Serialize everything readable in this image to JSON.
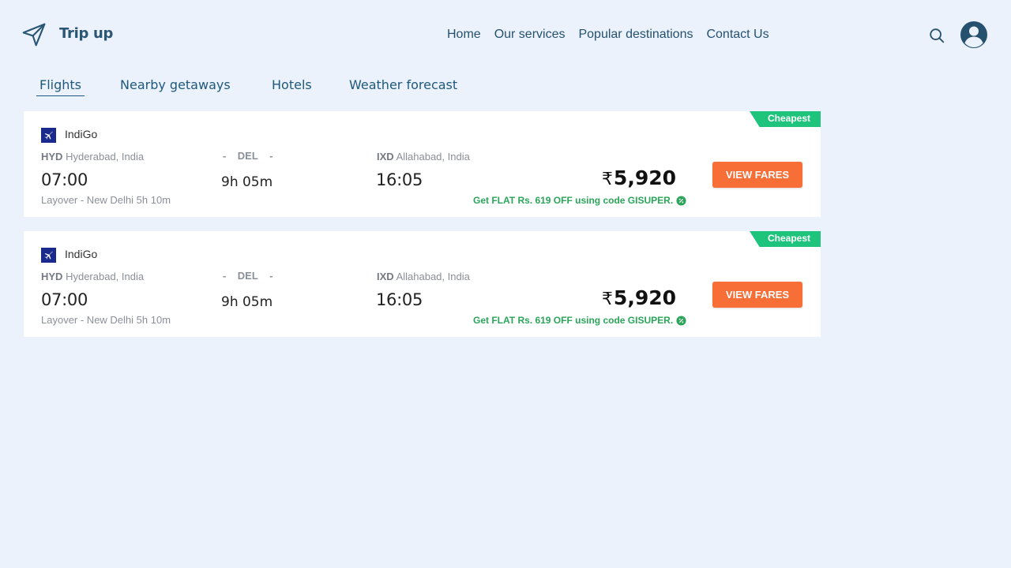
{
  "header": {
    "brand": "Trip up",
    "nav": [
      "Home",
      "Our services",
      "Popular destinations",
      "Contact Us"
    ]
  },
  "tabs": [
    "Flights",
    "Nearby getaways",
    "Hotels",
    "Weather forecast"
  ],
  "active_tab": "Flights",
  "flights": [
    {
      "badge": "Cheapest",
      "airline": "IndiGo",
      "dep_code": "HYD",
      "dep_city": "Hyderabad, India",
      "via_left": "-",
      "via_code": "DEL",
      "via_right": "-",
      "arr_code": "IXD",
      "arr_city": "Allahabad, India",
      "dep_time": "07:00",
      "duration": "9h 05m",
      "arr_time": "16:05",
      "layover": "Layover - New Delhi 5h 10m",
      "currency": "₹",
      "price": "5,920",
      "offer": "Get FLAT Rs. 619 OFF using code GISUPER.",
      "button": "VIEW FARES"
    },
    {
      "badge": "Cheapest",
      "airline": "IndiGo",
      "dep_code": "HYD",
      "dep_city": "Hyderabad, India",
      "via_left": "-",
      "via_code": "DEL",
      "via_right": "-",
      "arr_code": "IXD",
      "arr_city": "Allahabad, India",
      "dep_time": "07:00",
      "duration": "9h 05m",
      "arr_time": "16:05",
      "layover": "Layover - New Delhi 5h 10m",
      "currency": "₹",
      "price": "5,920",
      "offer": "Get FLAT Rs. 619 OFF using code GISUPER.",
      "button": "VIEW FARES"
    }
  ],
  "colors": {
    "background": "#ebf2fc",
    "primary": "#25516f",
    "badge": "#1fc47c",
    "button": "#f76e37",
    "offer": "#2ba55a",
    "airline_logo": "#1a2a8c"
  },
  "icons": [
    "paper-plane-icon",
    "search-icon",
    "user-avatar-icon",
    "airline-logo-icon",
    "discount-icon"
  ]
}
